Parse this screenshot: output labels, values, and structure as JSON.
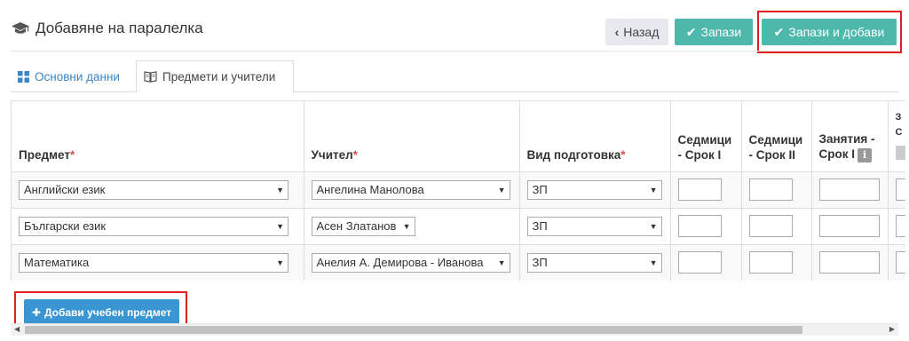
{
  "header": {
    "title": "Добавяне на паралелка",
    "back_label": "Назад",
    "save_label": "Запази",
    "save_add_label": "Запази и добави"
  },
  "tabs": [
    {
      "label": "Основни данни",
      "active": false
    },
    {
      "label": "Предмети и учители",
      "active": true
    }
  ],
  "table": {
    "columns": {
      "subject": "Предмет",
      "teacher": "Учител",
      "prep_type": "Вид подготовка",
      "weeks_1_a": "Седмици",
      "weeks_1_b": "- Срок I",
      "weeks_2_a": "Седмици",
      "weeks_2_b": "- Срок II",
      "classes_1_a": "Занятия -",
      "classes_1_b": "Срок I",
      "partial_a": "З",
      "partial_b": "С"
    },
    "rows": [
      {
        "subject": "Английски език",
        "teacher": "Ангелина Манолова",
        "prep_type": "ЗП"
      },
      {
        "subject": "Български език",
        "teacher": "Асен Златанов",
        "prep_type": "ЗП"
      },
      {
        "subject": "Математика",
        "teacher": "Анелия А. Демирова - Иванова",
        "prep_type": "ЗП"
      }
    ]
  },
  "add_subject_label": "Добави учебен предмет",
  "colors": {
    "teal_button": "#4fb8ad",
    "blue_button": "#3a95d3",
    "highlight": "#e0201c",
    "required": "#d9534f",
    "tab_link": "#3a87c8"
  }
}
